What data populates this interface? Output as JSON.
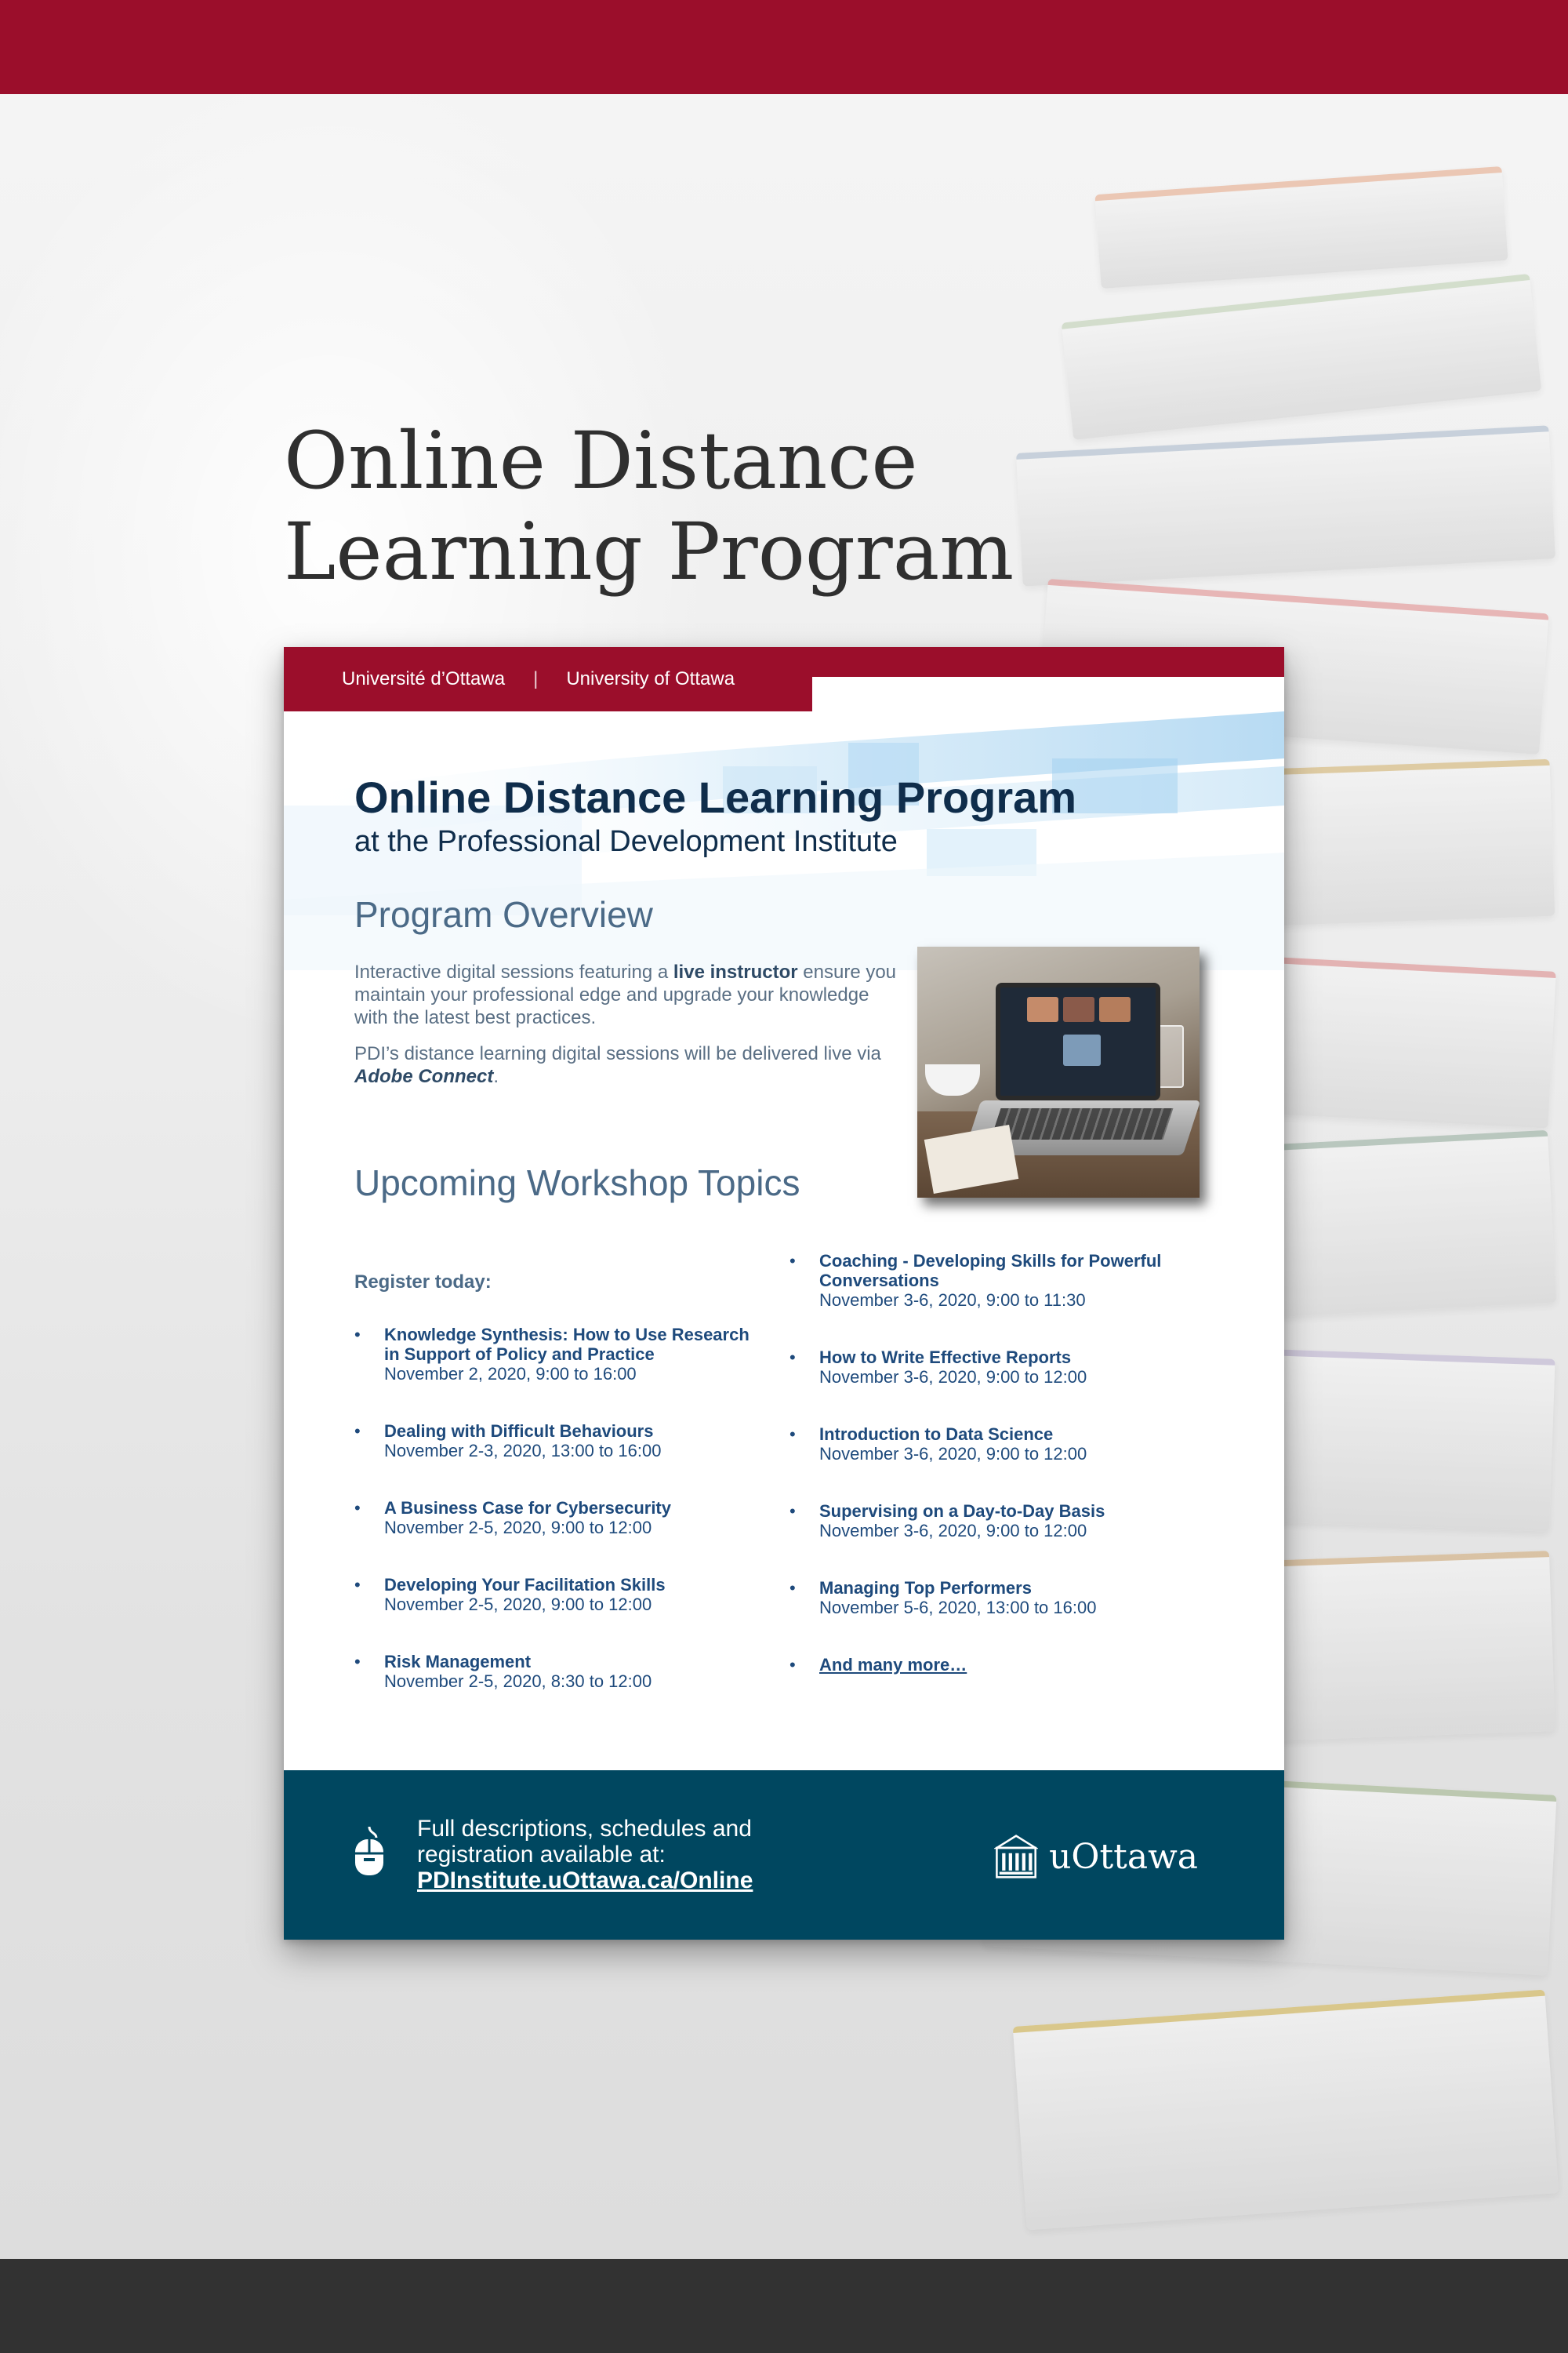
{
  "page": {
    "title_line1": "Online Distance",
    "title_line2": "Learning Program"
  },
  "colors": {
    "brand_red": "#9b0e2b",
    "brand_teal": "#004760",
    "heading_navy": "#0f2d4b",
    "section_blue": "#4b6a87",
    "topic_blue": "#1e4a7c"
  },
  "flyer": {
    "university_fr": "Université d’Ottawa",
    "separator": "|",
    "university_en": "University of Ottawa",
    "heading": "Online Distance Learning Program",
    "subheading": "at the Professional Development Institute",
    "overview": {
      "heading": "Program Overview",
      "p1_before": "Interactive digital sessions featuring a ",
      "p1_bold": "live instructor",
      "p1_after": " ensure you maintain your professional edge and upgrade your knowledge with the latest best practices.",
      "p2_before": "PDI’s distance learning digital sessions will be delivered live via ",
      "p2_emph": "Adobe Connect",
      "p2_after": "."
    },
    "workshops": {
      "heading": "Upcoming Workshop Topics",
      "register": "Register today:",
      "left": [
        {
          "title": "Knowledge Synthesis: How to Use Research in Support of Policy and Practice",
          "date": "November 2, 2020, 9:00 to 16:00"
        },
        {
          "title": "Dealing with Difficult Behaviours",
          "date": "November 2-3, 2020, 13:00 to 16:00"
        },
        {
          "title": "A Business Case for Cybersecurity",
          "date": "November 2-5, 2020, 9:00 to 12:00"
        },
        {
          "title": "Developing Your Facilitation Skills",
          "date": "November 2-5, 2020, 9:00 to 12:00"
        },
        {
          "title": "Risk Management",
          "date": "November 2-5, 2020, 8:30 to 12:00"
        }
      ],
      "right": [
        {
          "title": "Coaching - Developing Skills for Powerful Conversations",
          "date": "November 3-6, 2020, 9:00 to 11:30"
        },
        {
          "title": "How to Write Effective Reports",
          "date": "November 3-6, 2020, 9:00 to 12:00"
        },
        {
          "title": "Introduction to Data Science",
          "date": "November 3-6, 2020, 9:00 to 12:00"
        },
        {
          "title": "Supervising on a Day-to-Day Basis",
          "date": "November 3-6, 2020, 9:00 to 12:00"
        },
        {
          "title": "Managing Top Performers",
          "date": "November 5-6, 2020, 13:00 to 16:00"
        }
      ],
      "more": "And many more…",
      "bullet": "•"
    },
    "footer": {
      "text": "Full descriptions, schedules and registration available at:",
      "link": "PDInstitute.uOttawa.ca/Online",
      "icon": "computer-mouse-icon",
      "logo_text": "uOttawa",
      "logo_icon": "university-building-icon"
    }
  }
}
